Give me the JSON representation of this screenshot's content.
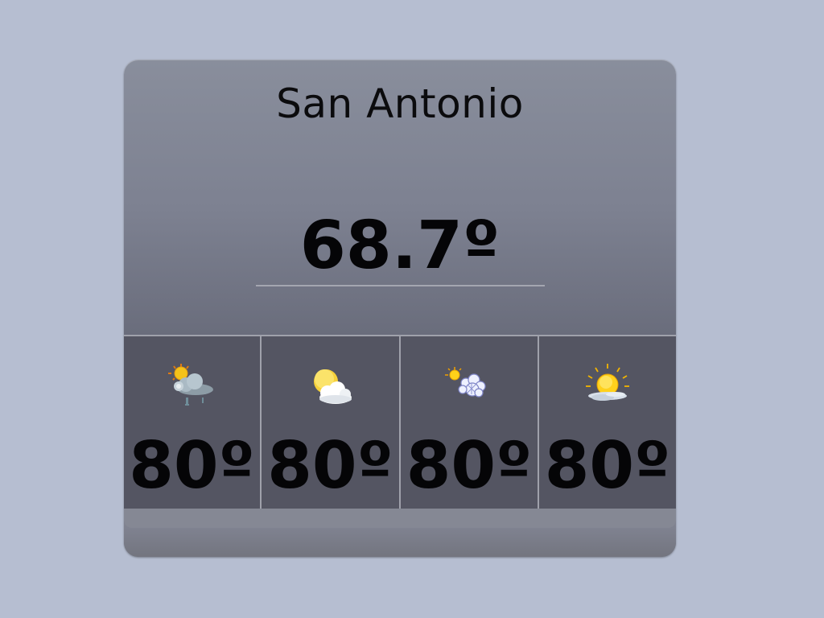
{
  "widget": {
    "city": "San Antonio",
    "current_temp": "68.7º"
  },
  "forecast": [
    {
      "icon": "thunderstorm-sun-icon",
      "temp": "80º"
    },
    {
      "icon": "partly-cloudy-icon",
      "temp": "80º"
    },
    {
      "icon": "sun-snow-icon",
      "temp": "80º"
    },
    {
      "icon": "sunrise-sun-icon",
      "temp": "80º"
    }
  ],
  "colors": {
    "background": "#b6bed1",
    "panel": "#545562",
    "divider": "#9fa1ab",
    "text": "#050507"
  }
}
